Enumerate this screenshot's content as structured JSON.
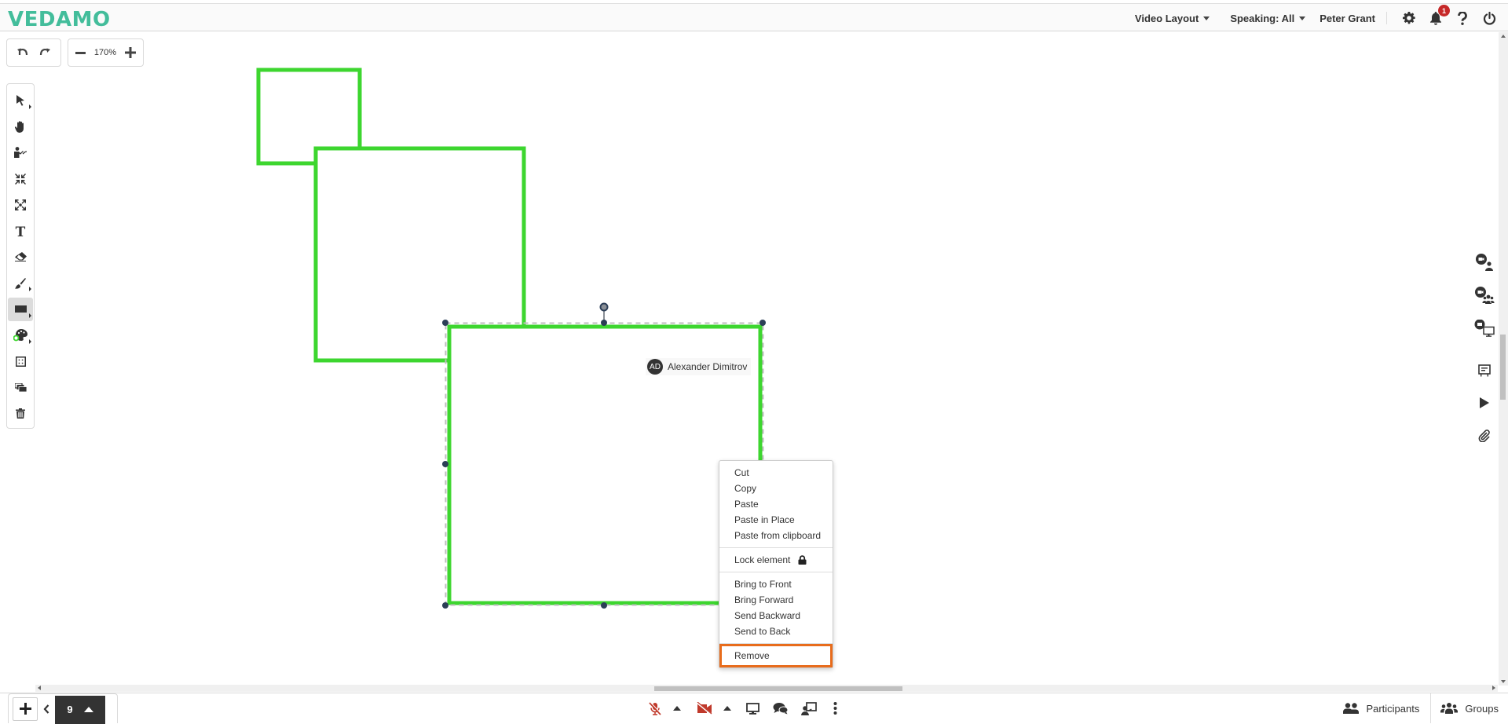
{
  "app": {
    "logo": "VEDAMO"
  },
  "header": {
    "video_layout": "Video Layout",
    "speaking": "Speaking: All",
    "username": "Peter Grant",
    "notification_count": "1",
    "icons": [
      "gear-icon",
      "bell-icon",
      "help-icon",
      "power-icon"
    ]
  },
  "history": {
    "undo_icon": "undo-icon",
    "redo_icon": "redo-icon"
  },
  "zoom": {
    "level": "170%"
  },
  "toolbar": {
    "tools": [
      {
        "name": "select",
        "icon": "pointer-icon",
        "has_submenu": true
      },
      {
        "name": "pan",
        "icon": "hand-icon",
        "has_submenu": false
      },
      {
        "name": "presenter-pointer",
        "icon": "presenter-icon",
        "has_submenu": false
      },
      {
        "name": "fit-content",
        "icon": "compress-icon",
        "has_submenu": false
      },
      {
        "name": "expand",
        "icon": "expand-icon",
        "has_submenu": false
      },
      {
        "name": "text",
        "icon": "text-icon",
        "has_submenu": false
      },
      {
        "name": "eraser",
        "icon": "eraser-icon",
        "has_submenu": false
      },
      {
        "name": "brush",
        "icon": "brush-icon",
        "has_submenu": true
      },
      {
        "name": "shape-rectangle",
        "icon": "rectangle-icon",
        "has_submenu": true,
        "active": true
      },
      {
        "name": "color",
        "icon": "palette-icon",
        "has_submenu": true
      },
      {
        "name": "grid",
        "icon": "grid-icon",
        "has_submenu": false
      },
      {
        "name": "layers",
        "icon": "layers-icon",
        "has_submenu": false
      },
      {
        "name": "delete",
        "icon": "trash-icon",
        "has_submenu": false
      }
    ],
    "current_color": "#3dd62f"
  },
  "canvas": {
    "shape_color": "#3dd62f",
    "selection_handle_color": "#2c3e57",
    "shapes": [
      "rectangle",
      "rectangle",
      "rectangle"
    ],
    "selected_shape_owner": {
      "initials": "AD",
      "name": "Alexander Dimitrov"
    }
  },
  "context_menu": {
    "groups": [
      [
        "Cut",
        "Copy",
        "Paste",
        "Paste in Place",
        "Paste from clipboard"
      ],
      [
        "Lock element"
      ],
      [
        "Bring to Front",
        "Bring Forward",
        "Send Backward",
        "Send to Back"
      ],
      [
        "Remove"
      ]
    ],
    "highlight_color": "#e86c1c"
  },
  "right_rail": {
    "items": [
      {
        "name": "video-single",
        "icon": "camera-person-icon"
      },
      {
        "name": "video-group",
        "icon": "camera-group-icon"
      },
      {
        "name": "video-screen",
        "icon": "camera-screen-icon"
      },
      {
        "name": "whiteboard",
        "icon": "board-icon"
      },
      {
        "name": "play",
        "icon": "play-icon"
      },
      {
        "name": "attachments",
        "icon": "paperclip-icon"
      }
    ]
  },
  "bottom": {
    "page_number": "9",
    "media": {
      "mic_state": "muted",
      "camera_state": "off",
      "accent_off": "#c0392b"
    },
    "participants_label": "Participants",
    "groups_label": "Groups"
  }
}
